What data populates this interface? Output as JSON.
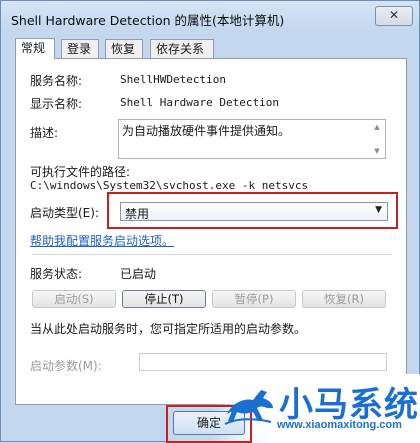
{
  "window": {
    "title": "Shell Hardware Detection 的属性(本地计算机)",
    "close_glyph": "✕"
  },
  "tabs": [
    {
      "label": "常规",
      "active": true
    },
    {
      "label": "登录",
      "active": false
    },
    {
      "label": "恢复",
      "active": false
    },
    {
      "label": "依存关系",
      "active": false
    }
  ],
  "general": {
    "service_name_label": "服务名称:",
    "service_name_value": "ShellHWDetection",
    "display_name_label": "显示名称:",
    "display_name_value": "Shell Hardware Detection",
    "description_label": "描述:",
    "description_value": "为自动播放硬件事件提供通知。",
    "exec_path_label": "可执行文件的路径:",
    "exec_path_value": "C:\\windows\\System32\\svchost.exe -k netsvcs",
    "startup_type_label": "启动类型(E):",
    "startup_type_value": "禁用",
    "help_link": "帮助我配置服务启动选项。",
    "status_label": "服务状态:",
    "status_value": "已启动",
    "start_hint": "当从此处启动服务时，您可指定所适用的启动参数。",
    "start_params_label": "启动参数(M):",
    "start_params_value": ""
  },
  "buttons": {
    "start": "启动(S)",
    "stop": "停止(T)",
    "pause": "暂停(P)",
    "resume": "恢复(R)",
    "ok": "确定"
  },
  "watermark": {
    "brand": "小马系统",
    "url": "www.xiaomaxitong.com"
  },
  "colors": {
    "highlight": "#c8201f",
    "link": "#1f5ec8",
    "brand": "#1b6fd0"
  }
}
